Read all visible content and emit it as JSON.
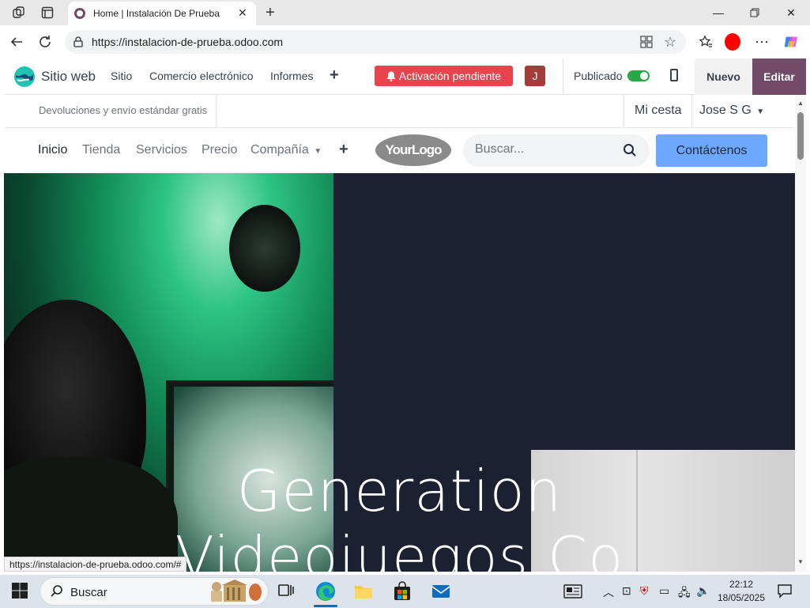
{
  "browser": {
    "tab_title": "Home | Instalación De Prueba",
    "url": "https://instalacion-de-prueba.odoo.com",
    "status_url": "https://instalacion-de-prueba.odoo.com/#"
  },
  "odoo_bar": {
    "app_name": "Sitio web",
    "menu": [
      "Sitio",
      "Comercio electrónico",
      "Informes"
    ],
    "activation_label": "Activación pendiente",
    "avatar_letter": "J",
    "published_label": "Publicado",
    "published": true,
    "new_label": "Nuevo",
    "edit_label": "Editar"
  },
  "site_header": {
    "promo": "Devoluciones y envío estándar gratis",
    "cart_label": "Mi cesta",
    "user_name": "Jose S G"
  },
  "site_nav": {
    "items": [
      "Inicio",
      "Tienda",
      "Servicios",
      "Precio",
      "Compañía"
    ],
    "logo_text": "YourLogo",
    "search_placeholder": "Buscar...",
    "contact_label": "Contáctenos"
  },
  "hero": {
    "title_line1": "Generation",
    "title_line2": "Videojuegos Co"
  },
  "taskbar": {
    "search_label": "Buscar",
    "time": "22:12",
    "date": "18/05/2025"
  },
  "colors": {
    "odoo_purple": "#714b67",
    "activation_red": "#e8444d",
    "contact_blue": "#6ea8fe",
    "hero_bg": "#1b2130"
  }
}
